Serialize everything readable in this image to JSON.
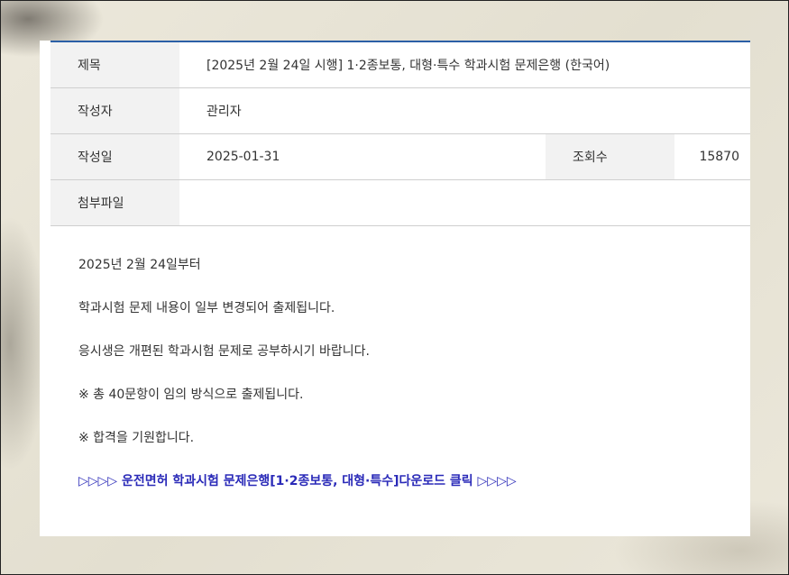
{
  "post": {
    "title_label": "제목",
    "title": "[2025년 2월 24일 시행] 1·2종보통, 대형·특수 학과시험 문제은행 (한국어)",
    "author_label": "작성자",
    "author": "관리자",
    "date_label": "작성일",
    "date": "2025-01-31",
    "views_label": "조회수",
    "views": "15870",
    "attachment_label": "첨부파일",
    "attachment": ""
  },
  "body": {
    "lines": [
      "2025년 2월 24일부터",
      "학과시험 문제 내용이 일부 변경되어 출제됩니다.",
      "응시생은 개편된 학과시험 문제로 공부하시기 바랍니다.",
      "※ 총 40문항이 임의 방식으로 출제됩니다.",
      "※ 합격을 기원합니다."
    ],
    "download_link": "▷▷▷▷ 운전면허 학과시험 문제은행[1·2종보통, 대형·특수]다운로드 클릭 ▷▷▷▷"
  },
  "colors": {
    "header_border": "#2b5fa6",
    "label_bg": "#f2f2f2",
    "link": "#2a2ab8"
  }
}
